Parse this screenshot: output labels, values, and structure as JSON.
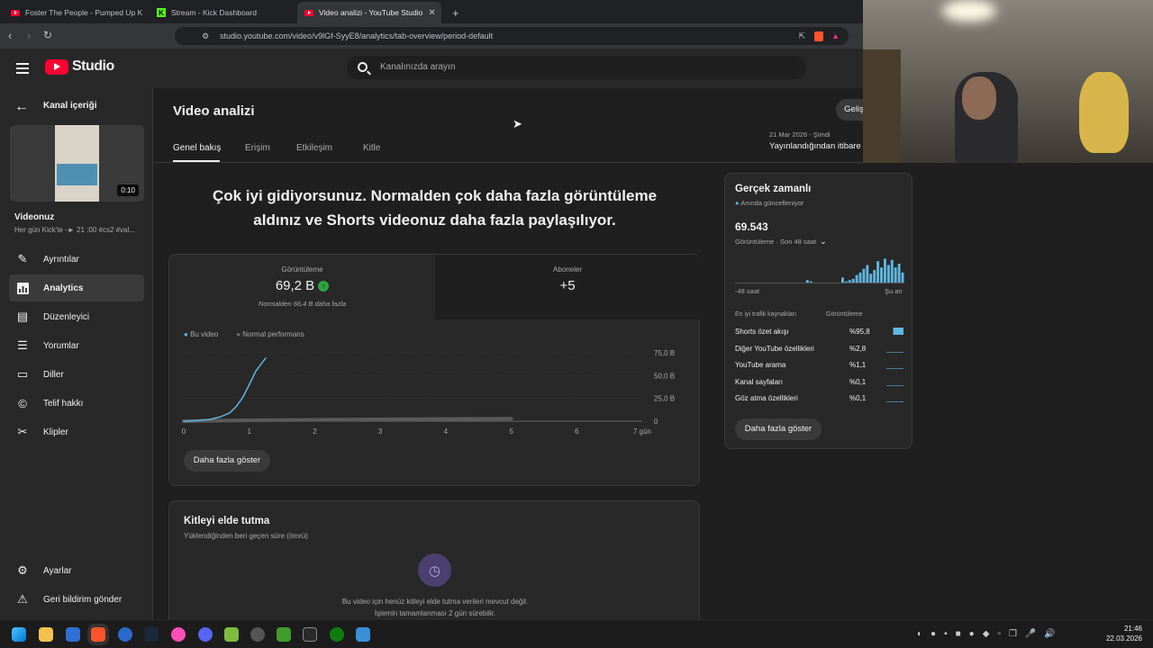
{
  "browser": {
    "tabs": [
      {
        "title": "Foster The People - Pumped Up K"
      },
      {
        "title": "Stream - Kick Dashboard"
      },
      {
        "title": "Video analizi - YouTube Studio"
      }
    ],
    "url": "studio.youtube.com/video/v9lGf-SyyE8/analytics/tab-overview/period-default"
  },
  "header": {
    "logo_text": "Studio",
    "search_placeholder": "Kanalınızda arayın"
  },
  "sidebar": {
    "back_label": "Kanal içeriği",
    "video_duration": "0:10",
    "video_title": "Videonuz",
    "video_desc": "Her gün Kick'te -► 21 :00 #cs2 #val...",
    "items": [
      {
        "label": "Ayrıntılar",
        "icon": "pencil-icon"
      },
      {
        "label": "Analytics",
        "icon": "analytics-icon"
      },
      {
        "label": "Düzenleyici",
        "icon": "editor-icon"
      },
      {
        "label": "Yorumlar",
        "icon": "comments-icon"
      },
      {
        "label": "Diller",
        "icon": "subtitles-icon"
      },
      {
        "label": "Telif hakkı",
        "icon": "copyright-icon"
      },
      {
        "label": "Klipler",
        "icon": "scissors-icon"
      }
    ],
    "settings_label": "Ayarlar",
    "feedback_label": "Geri bildirim gönder"
  },
  "main": {
    "page_title": "Video analizi",
    "advanced_button": "Geliş",
    "tabs": [
      "Genel bakış",
      "Erişim",
      "Etkileşim",
      "Kitle"
    ],
    "date_range": "21 Mar 2026 - Şimdi",
    "period_label": "Yayınlandığından itibare",
    "headline": "Çok iyi gidiyorsunuz. Normalden çok daha fazla görüntüleme aldınız ve Shorts videonuz daha fazla paylaşılıyor.",
    "views_label": "Görüntüleme",
    "views_value": "69,2 B",
    "views_note": "Normalden 66,4 B daha fazla",
    "subs_label": "Aboneler",
    "subs_value": "+5",
    "legend_this": "Bu video",
    "legend_normal": "Normal performans",
    "show_more": "Daha fazla göster",
    "retention_title": "Kitleyi elde tutma",
    "retention_sub": "Yüklendiğinden beri geçen süre (ömrü)",
    "retention_msg1": "Bu video için henüz kitleyi elde tutma verileri mevcut değil.",
    "retention_msg2": "İşlemin tamamlanması 2 gün sürebilir."
  },
  "chart_data": {
    "type": "line",
    "x_ticks": [
      "0",
      "1",
      "2",
      "3",
      "4",
      "5",
      "6",
      "7 gün"
    ],
    "y_ticks": [
      "75,0 B",
      "50,0 B",
      "25,0 B",
      "0"
    ],
    "ylim": [
      0,
      75000
    ],
    "series": [
      {
        "name": "Bu video",
        "color": "#5fb6e0",
        "points": [
          [
            0,
            0
          ],
          [
            0.2,
            800
          ],
          [
            0.4,
            2000
          ],
          [
            0.55,
            4500
          ],
          [
            0.7,
            9000
          ],
          [
            0.8,
            16000
          ],
          [
            0.9,
            26000
          ],
          [
            1.0,
            40000
          ],
          [
            1.1,
            55000
          ],
          [
            1.25,
            69200
          ]
        ]
      },
      {
        "name": "Normal performans",
        "color": "#5a5a5a",
        "points": [
          [
            0,
            0
          ],
          [
            1,
            1000
          ],
          [
            3,
            2000
          ],
          [
            5,
            2800
          ]
        ]
      }
    ]
  },
  "realtime": {
    "title": "Gerçek zamanlı",
    "live_label": "Anında güncelleniyor",
    "value": "69.543",
    "sub_label": "Görüntüleme · Son 48 saat",
    "axis_start": "-48 saat",
    "axis_end": "Şu an",
    "traffic_header": "En iyi trafik kaynakları",
    "traffic_col": "Görüntüleme",
    "sources": [
      {
        "name": "Shorts özet akışı",
        "value": "%95,8"
      },
      {
        "name": "Diğer YouTube özellikleri",
        "value": "%2,8"
      },
      {
        "name": "YouTube arama",
        "value": "%1,1"
      },
      {
        "name": "Kanal sayfaları",
        "value": "%0,1"
      },
      {
        "name": "Göz atma özellikleri",
        "value": "%0,1"
      }
    ],
    "button": "Daha fazla göster",
    "bars": [
      0,
      0,
      0,
      0,
      0,
      0,
      0,
      0,
      0,
      0,
      0,
      0,
      0,
      0,
      0,
      0,
      0,
      0,
      0,
      0,
      0.1,
      0.05,
      0,
      0,
      0,
      0,
      0,
      0,
      0,
      0,
      0.2,
      0.05,
      0.1,
      0.15,
      0.3,
      0.4,
      0.55,
      0.7,
      0.35,
      0.5,
      0.85,
      0.6,
      0.95,
      0.7,
      0.9,
      0.6,
      0.75,
      0.4
    ]
  },
  "taskbar": {
    "time": "21:46",
    "date": "22.03.2026"
  }
}
